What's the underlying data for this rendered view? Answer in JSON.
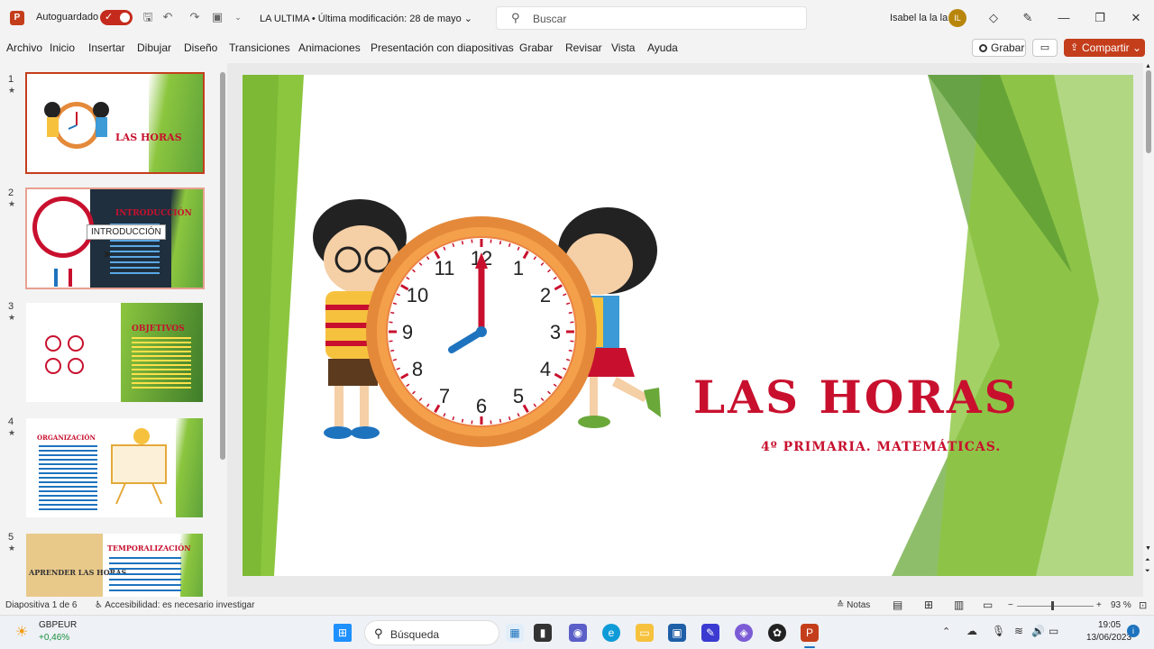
{
  "titlebar": {
    "app_logo": "P",
    "autosave_label": "Autoguardado",
    "autosave_on": true,
    "doc_title": "LA ULTIMA • Última modificación: 28 de mayo",
    "search_placeholder": "Buscar",
    "user_name": "Isabel la la la",
    "user_initials": "IL"
  },
  "menu": [
    "Archivo",
    "Inicio",
    "Insertar",
    "Dibujar",
    "Diseño",
    "Transiciones",
    "Animaciones",
    "Presentación con diapositivas",
    "Grabar",
    "Revisar",
    "Vista",
    "Ayuda"
  ],
  "actions": {
    "record_label": "Grabar",
    "share_label": "Compartir"
  },
  "thumbnails": [
    {
      "num": "1",
      "title": "LAS HORAS",
      "selected": true
    },
    {
      "num": "2",
      "title": "INTRODUCCIÓN",
      "selected": false
    },
    {
      "num": "3",
      "title": "OBJETIVOS",
      "selected": false
    },
    {
      "num": "4",
      "title": "ORGANIZACIÓN",
      "selected": false
    },
    {
      "num": "5",
      "title": "TEMPORALIZACIÓN",
      "selected": false
    }
  ],
  "thumb_extra": {
    "slide5_text": "APRENDER LAS HORAS"
  },
  "tooltip": "INTRODUCCIÓN",
  "slide": {
    "title": "LAS HORAS",
    "subtitle": "4º PRIMARIA. MATEMÁTICAS.",
    "clock_numbers": [
      "12",
      "1",
      "2",
      "3",
      "4",
      "5",
      "6",
      "7",
      "8",
      "9",
      "10",
      "11"
    ]
  },
  "status": {
    "slide_info": "Diapositiva 1 de 6",
    "accessibility": "Accesibilidad: es necesario investigar",
    "notes": "Notas",
    "zoom": "93 %"
  },
  "taskbar": {
    "stock_name": "GBPEUR",
    "stock_change": "+0,46%",
    "search": "Búsqueda",
    "time": "19:05",
    "date": "13/06/2023"
  },
  "colors": {
    "accent": "#c43e1c",
    "slide_red": "#c8102e",
    "green": "#8cc63f"
  }
}
